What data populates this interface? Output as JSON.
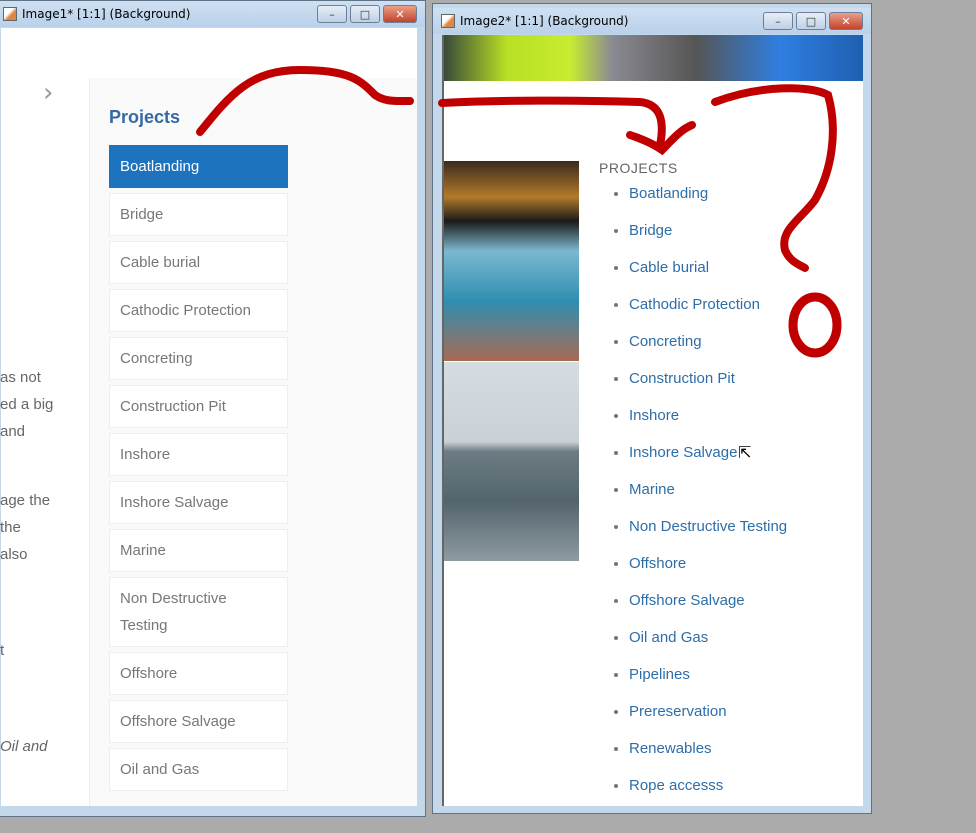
{
  "window1": {
    "title": "Image1* [1:1] (Background)",
    "chevron": "chevron-right-icon",
    "left_text": [
      "as not",
      "ed a big",
      " and",
      "age the",
      "the",
      "also",
      "t",
      "Oil and"
    ],
    "sidebar": {
      "title": "Projects",
      "items": [
        "Boatlanding",
        "Bridge",
        "Cable burial",
        "Cathodic Protection",
        "Concreting",
        "Construction Pit",
        "Inshore",
        "Inshore Salvage",
        "Marine",
        "Non Destructive Testing",
        "Offshore",
        "Offshore Salvage",
        "Oil and Gas"
      ],
      "active": "Boatlanding"
    }
  },
  "window2": {
    "title": "Image2* [1:1] (Background)",
    "list_heading": "PROJECTS",
    "items": [
      "Boatlanding",
      "Bridge",
      "Cable burial",
      "Cathodic Protection",
      "Concreting",
      "Construction Pit",
      "Inshore",
      "Inshore Salvage",
      "Marine",
      "Non Destructive Testing",
      "Offshore",
      "Offshore Salvage",
      "Oil and Gas",
      "Pipelines",
      "Prereservation",
      "Renewables",
      "Rope accesss"
    ]
  },
  "controls": {
    "minimize": "–",
    "maximize": "□",
    "close": "✕"
  },
  "colors": {
    "accent": "#1e73be",
    "link": "#2d6ea8",
    "annotation": "#c00000"
  }
}
